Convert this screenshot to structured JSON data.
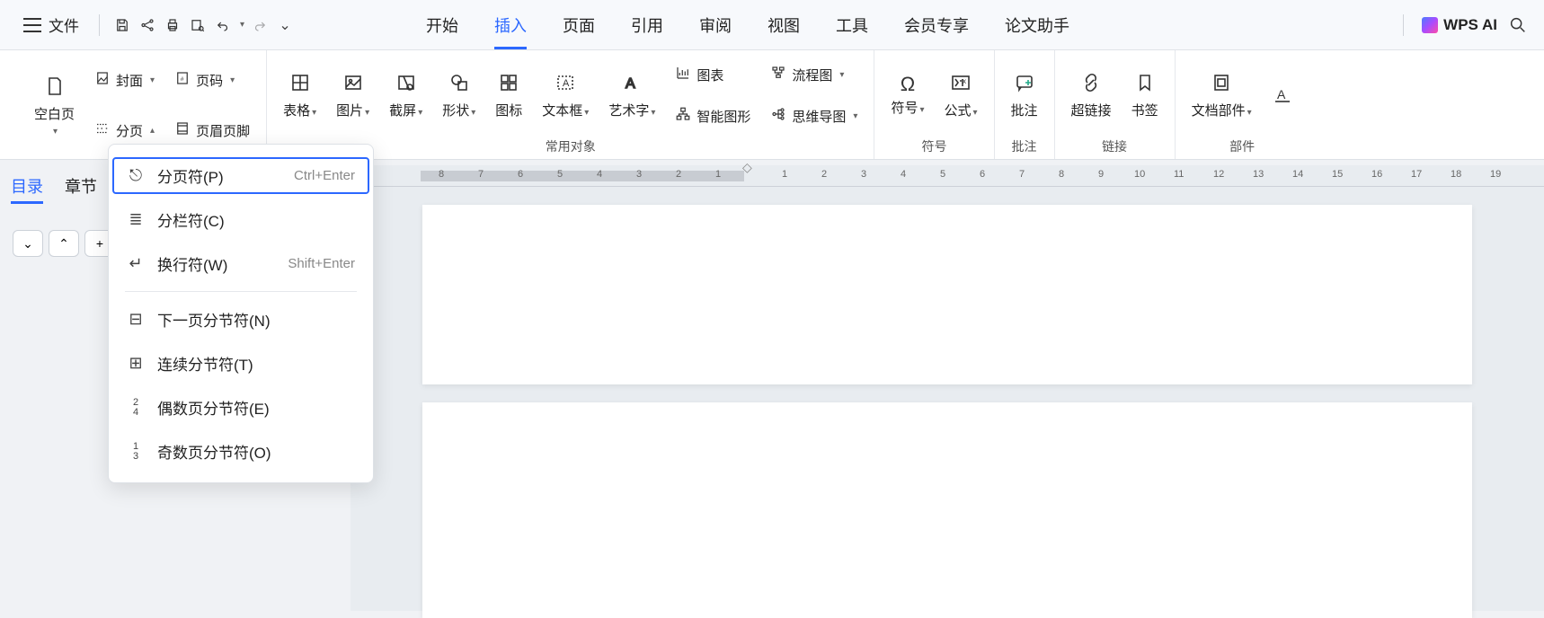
{
  "topbar": {
    "file": "文件",
    "tabs": [
      "开始",
      "插入",
      "页面",
      "引用",
      "审阅",
      "视图",
      "工具",
      "会员专享",
      "论文助手"
    ],
    "active_tab": 1,
    "ai_label": "WPS AI"
  },
  "ribbon": {
    "g1": {
      "blank_page": "空白页",
      "cover": "封面",
      "page_number": "页码",
      "page_break": "分页",
      "header_footer": "页眉页脚"
    },
    "g2": {
      "table": "表格",
      "picture": "图片",
      "screenshot": "截屏",
      "shape": "形状",
      "icon": "图标",
      "text_box": "文本框",
      "word_art": "艺术字",
      "chart": "图表",
      "smart_art": "智能图形",
      "flowchart": "流程图",
      "mindmap": "思维导图",
      "group_label": "常用对象"
    },
    "g3": {
      "symbol": "符号",
      "formula": "公式",
      "group_label": "符号"
    },
    "g4": {
      "comment": "批注",
      "group_label": "批注"
    },
    "g5": {
      "hyperlink": "超链接",
      "bookmark": "书签",
      "group_label": "链接"
    },
    "g6": {
      "doc_parts": "文档部件",
      "group_label": "部件"
    }
  },
  "dropdown": {
    "items": [
      {
        "label": "分页符(P)",
        "shortcut": "Ctrl+Enter"
      },
      {
        "label": "分栏符(C)",
        "shortcut": ""
      },
      {
        "label": "换行符(W)",
        "shortcut": "Shift+Enter"
      },
      {
        "label": "下一页分节符(N)",
        "shortcut": ""
      },
      {
        "label": "连续分节符(T)",
        "shortcut": ""
      },
      {
        "label": "偶数页分节符(E)",
        "shortcut": ""
      },
      {
        "label": "奇数页分节符(O)",
        "shortcut": ""
      }
    ]
  },
  "left_panel": {
    "tabs": [
      "目录",
      "章节"
    ],
    "active": 0
  },
  "ruler": {
    "left": [
      "8",
      "7",
      "6",
      "5",
      "4",
      "3",
      "2",
      "1"
    ],
    "right": [
      "1",
      "2",
      "3",
      "4",
      "5",
      "6",
      "7",
      "8",
      "9",
      "10",
      "11",
      "12",
      "13",
      "14",
      "15",
      "16",
      "17",
      "18",
      "19"
    ]
  }
}
